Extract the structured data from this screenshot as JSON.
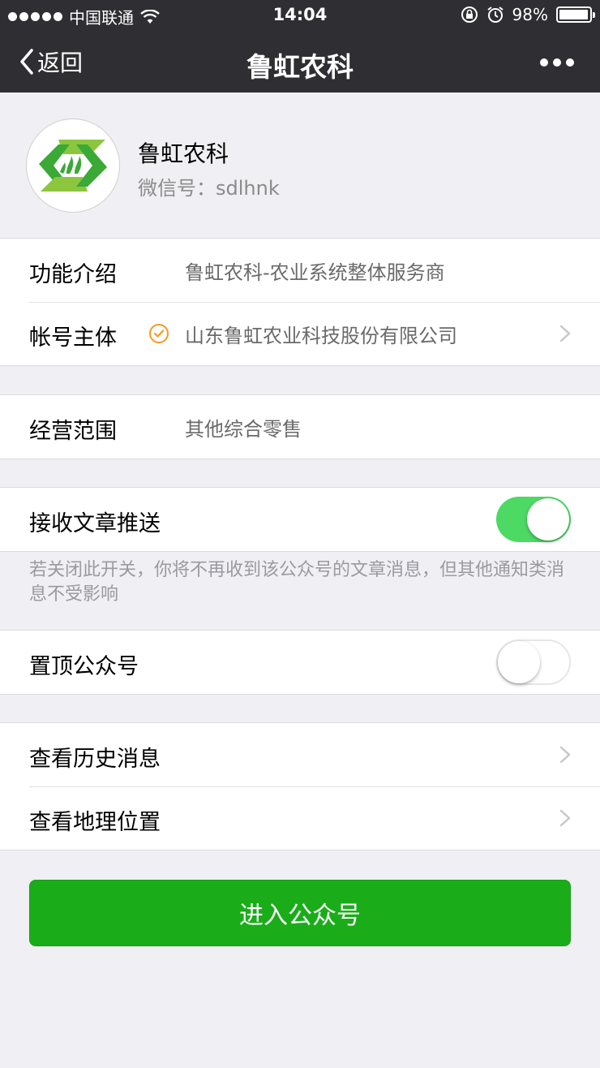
{
  "status_bar": {
    "carrier": "中国联通",
    "time": "14:04",
    "battery_text": "98%",
    "battery_level": 0.98
  },
  "nav": {
    "back_label": "返回",
    "title": "鲁虹农科"
  },
  "profile": {
    "name": "鲁虹农科",
    "wechat_id": "微信号：sdlhnk"
  },
  "info": {
    "intro_label": "功能介绍",
    "intro_value": "鲁虹农科-农业系统整体服务商",
    "entity_label": "帐号主体",
    "entity_value": "山东鲁虹农业科技股份有限公司",
    "scope_label": "经营范围",
    "scope_value": "其他综合零售"
  },
  "settings": {
    "receive_label": "接收文章推送",
    "receive_on": true,
    "receive_hint": "若关闭此开关，你将不再收到该公众号的文章消息，但其他通知类消息不受影响",
    "pin_label": "置顶公众号",
    "pin_on": false
  },
  "links": {
    "history_label": "查看历史消息",
    "location_label": "查看地理位置"
  },
  "enter_button": "进入公众号",
  "colors": {
    "nav_bg": "#2f2f33",
    "toggle_on": "#4cd964",
    "primary_button": "#1aad19",
    "verified_badge": "#f59a23"
  }
}
